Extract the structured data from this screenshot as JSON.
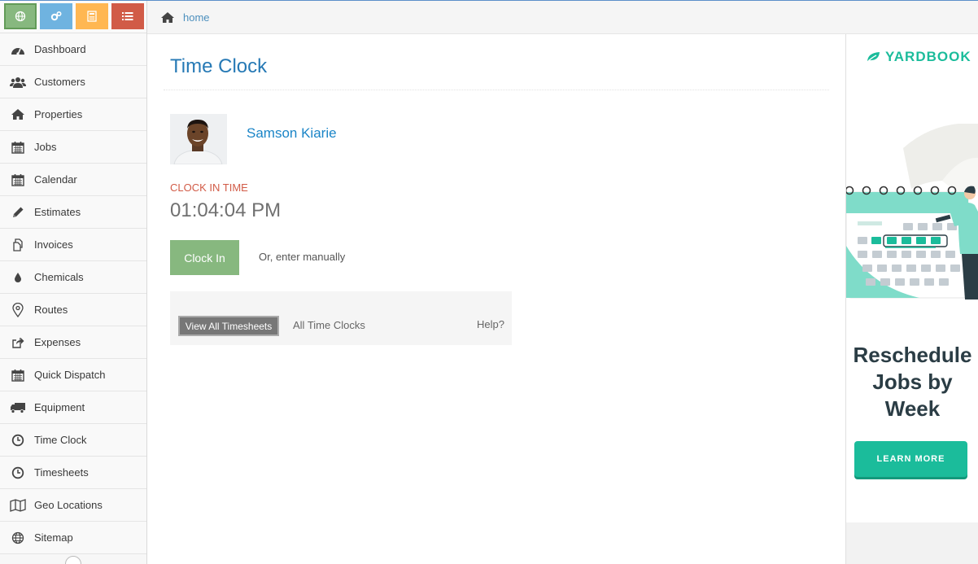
{
  "shortcuts": [
    {
      "name": "globe-icon",
      "color": "#87b87f"
    },
    {
      "name": "cogs-icon",
      "color": "#6fb3e0"
    },
    {
      "name": "calculator-icon",
      "color": "#ffb752"
    },
    {
      "name": "list-icon",
      "color": "#d15b47"
    }
  ],
  "sidebar": {
    "items": [
      {
        "label": "Dashboard",
        "icon": "dashboard-icon"
      },
      {
        "label": "Customers",
        "icon": "users-icon"
      },
      {
        "label": "Properties",
        "icon": "home-icon"
      },
      {
        "label": "Jobs",
        "icon": "calendar-icon"
      },
      {
        "label": "Calendar",
        "icon": "calendar-icon"
      },
      {
        "label": "Estimates",
        "icon": "pencil-icon"
      },
      {
        "label": "Invoices",
        "icon": "copy-icon"
      },
      {
        "label": "Chemicals",
        "icon": "tint-icon"
      },
      {
        "label": "Routes",
        "icon": "map-marker-icon"
      },
      {
        "label": "Expenses",
        "icon": "share-icon"
      },
      {
        "label": "Quick Dispatch",
        "icon": "calendar-icon"
      },
      {
        "label": "Equipment",
        "icon": "truck-icon"
      },
      {
        "label": "Time Clock",
        "icon": "clock-icon"
      },
      {
        "label": "Timesheets",
        "icon": "clock-icon"
      },
      {
        "label": "Geo Locations",
        "icon": "map-icon"
      },
      {
        "label": "Sitemap",
        "icon": "globe-icon"
      }
    ]
  },
  "breadcrumb": {
    "home_label": "home"
  },
  "page": {
    "title": "Time Clock",
    "user_name": "Samson Kiarie",
    "clock_label": "CLOCK IN TIME",
    "clock_time": "01:04:04 PM",
    "clock_button": "Clock In",
    "manual_label": "Or, enter manually",
    "view_timesheets": "View All Timesheets",
    "all_time_clocks": "All Time Clocks",
    "help": "Help?"
  },
  "ad": {
    "brand": "YARDBOOK",
    "headline_1": "Reschedule",
    "headline_2": "Jobs by",
    "headline_3": "Week",
    "cta": "LEARN MORE",
    "accent": "#1bbc9b"
  }
}
